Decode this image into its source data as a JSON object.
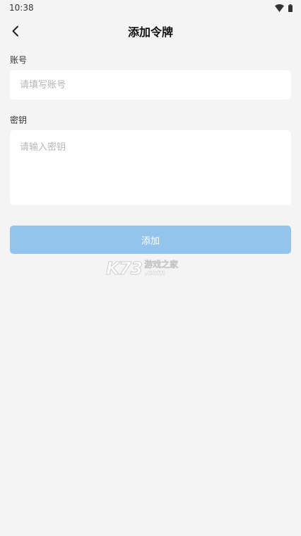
{
  "status_bar": {
    "time": "10:38",
    "icons": [
      "wifi-icon",
      "battery-icon"
    ]
  },
  "nav": {
    "back_icon": "chevron-left-icon",
    "title": "添加令牌"
  },
  "form": {
    "account": {
      "label": "账号",
      "placeholder": "请填写账号",
      "value": ""
    },
    "secret": {
      "label": "密钥",
      "placeholder": "请输入密钥",
      "value": ""
    },
    "submit_label": "添加"
  },
  "watermark": {
    "mark": "K73",
    "text_cn": "游戏之家",
    "text_domain": ".com"
  },
  "colors": {
    "background": "#f4f4f4",
    "input_background": "#ffffff",
    "button_disabled": "#94c4ec",
    "placeholder": "#b5b5b5"
  }
}
